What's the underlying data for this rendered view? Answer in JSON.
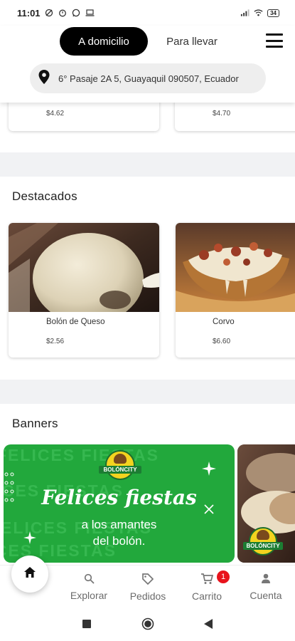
{
  "status_bar": {
    "time": "11:01",
    "battery": "34"
  },
  "header": {
    "tab_delivery": "A domicilio",
    "tab_pickup": "Para llevar",
    "address": "6° Pasaje 2A 5, Guayaquil 090507, Ecuador"
  },
  "top_products": [
    {
      "price": "$4.62"
    },
    {
      "price": "$4.70"
    }
  ],
  "featured": {
    "title": "Destacados",
    "items": [
      {
        "name": "Bolón de Queso",
        "price": "$2.56"
      },
      {
        "name": "Corvo",
        "price": "$6.60"
      }
    ]
  },
  "banners": {
    "title": "Banners",
    "brand": "BOLÓNCITY",
    "watermark": "FELICES FIESTAS",
    "headline": "Felices fiestas",
    "line1": "a los amantes",
    "line2": "del bolón."
  },
  "bottom_nav": {
    "explore": "Explorar",
    "orders": "Pedidos",
    "cart": "Carrito",
    "cart_count": "1",
    "account": "Cuenta"
  },
  "colors": {
    "accent": "#000000",
    "banner_green": "#22a83c",
    "badge_red": "#e8131c"
  }
}
